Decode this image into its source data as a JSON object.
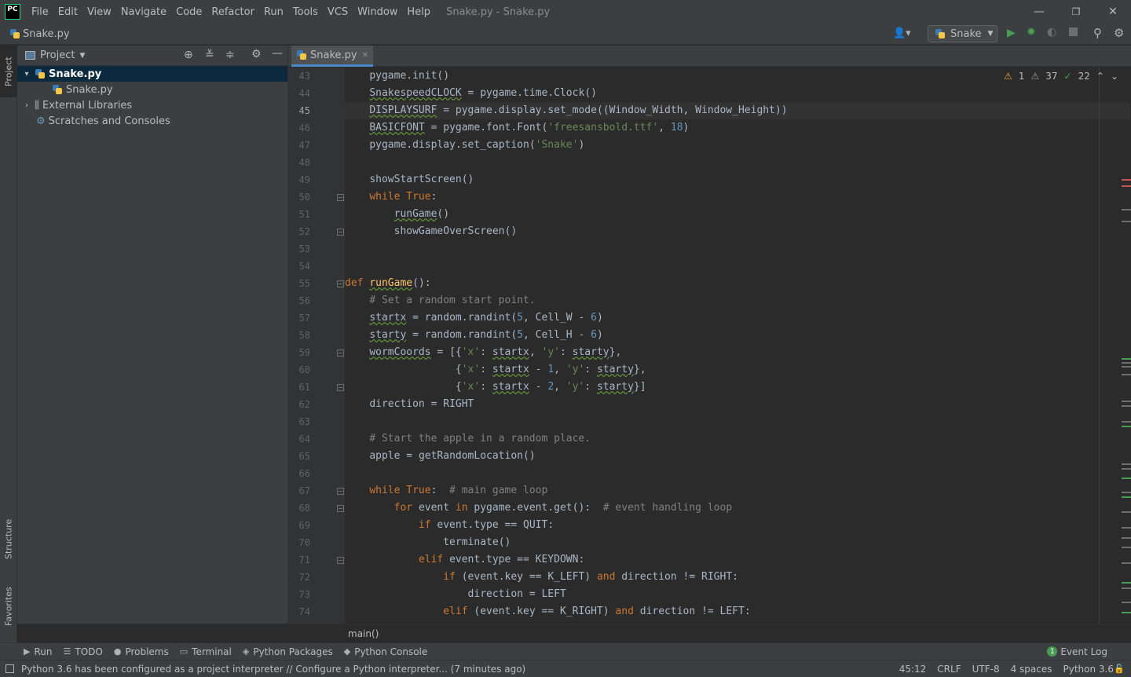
{
  "app": {
    "logo": "PC",
    "window_title": "Snake.py - Snake.py"
  },
  "menu": [
    "File",
    "Edit",
    "View",
    "Navigate",
    "Code",
    "Refactor",
    "Run",
    "Tools",
    "VCS",
    "Window",
    "Help"
  ],
  "navbar": {
    "breadcrumb_file": "Snake.py",
    "run_config": "Snake"
  },
  "left_strip": {
    "project": "Project",
    "structure": "Structure",
    "favorites": "Favorites"
  },
  "project_panel": {
    "title": "Project",
    "tree": [
      {
        "label": "Snake.py",
        "bold": true,
        "expanded": true
      },
      {
        "label": "Snake.py"
      },
      {
        "label": "External Libraries"
      },
      {
        "label": "Scratches and Consoles"
      }
    ]
  },
  "editor": {
    "tab": "Snake.py",
    "inspections": {
      "warnings_yellow": "1",
      "warnings_gray": "37",
      "ok": "22"
    },
    "lines": [
      {
        "n": "43",
        "t": "    pygame.init()"
      },
      {
        "n": "44",
        "t": "    SnakespeedCLOCK = pygame.time.Clock()"
      },
      {
        "n": "45",
        "t": "    DISPLAYSURF = pygame.display.set_mode((Window_Width, Window_Height))"
      },
      {
        "n": "46",
        "t": "    BASICFONT = pygame.font.Font('freesansbold.ttf', 18)"
      },
      {
        "n": "47",
        "t": "    pygame.display.set_caption('Snake')"
      },
      {
        "n": "48",
        "t": ""
      },
      {
        "n": "49",
        "t": "    showStartScreen()"
      },
      {
        "n": "50",
        "t": "    while True:"
      },
      {
        "n": "51",
        "t": "        runGame()"
      },
      {
        "n": "52",
        "t": "        showGameOverScreen()"
      },
      {
        "n": "53",
        "t": ""
      },
      {
        "n": "54",
        "t": ""
      },
      {
        "n": "55",
        "t": "def runGame():"
      },
      {
        "n": "56",
        "t": "    # Set a random start point."
      },
      {
        "n": "57",
        "t": "    startx = random.randint(5, Cell_W - 6)"
      },
      {
        "n": "58",
        "t": "    starty = random.randint(5, Cell_H - 6)"
      },
      {
        "n": "59",
        "t": "    wormCoords = [{'x': startx, 'y': starty},"
      },
      {
        "n": "60",
        "t": "                  {'x': startx - 1, 'y': starty},"
      },
      {
        "n": "61",
        "t": "                  {'x': startx - 2, 'y': starty}]"
      },
      {
        "n": "62",
        "t": "    direction = RIGHT"
      },
      {
        "n": "63",
        "t": ""
      },
      {
        "n": "64",
        "t": "    # Start the apple in a random place."
      },
      {
        "n": "65",
        "t": "    apple = getRandomLocation()"
      },
      {
        "n": "66",
        "t": ""
      },
      {
        "n": "67",
        "t": "    while True:  # main game loop"
      },
      {
        "n": "68",
        "t": "        for event in pygame.event.get():  # event handling loop"
      },
      {
        "n": "69",
        "t": "            if event.type == QUIT:"
      },
      {
        "n": "70",
        "t": "                terminate()"
      },
      {
        "n": "71",
        "t": "            elif event.type == KEYDOWN:"
      },
      {
        "n": "72",
        "t": "                if (event.key == K_LEFT) and direction != RIGHT:"
      },
      {
        "n": "73",
        "t": "                    direction = LEFT"
      },
      {
        "n": "74",
        "t": "                elif (event.key == K_RIGHT) and direction != LEFT:"
      }
    ],
    "breadcrumb": "main()"
  },
  "tool_windows": [
    "Run",
    "TODO",
    "Problems",
    "Terminal",
    "Python Packages",
    "Python Console"
  ],
  "event_log": {
    "count": "1",
    "label": "Event Log"
  },
  "status": {
    "message": "Python 3.6 has been configured as a project interpreter // Configure a Python interpreter... (7 minutes ago)",
    "position": "45:12",
    "line_sep": "CRLF",
    "encoding": "UTF-8",
    "indent": "4 spaces",
    "interpreter": "Python 3.6"
  },
  "colors": {
    "keyword": "#cc7832",
    "string": "#6a8759",
    "number": "#6897bb",
    "comment": "#808080",
    "function": "#ffc66d",
    "accent": "#4a88c7"
  }
}
